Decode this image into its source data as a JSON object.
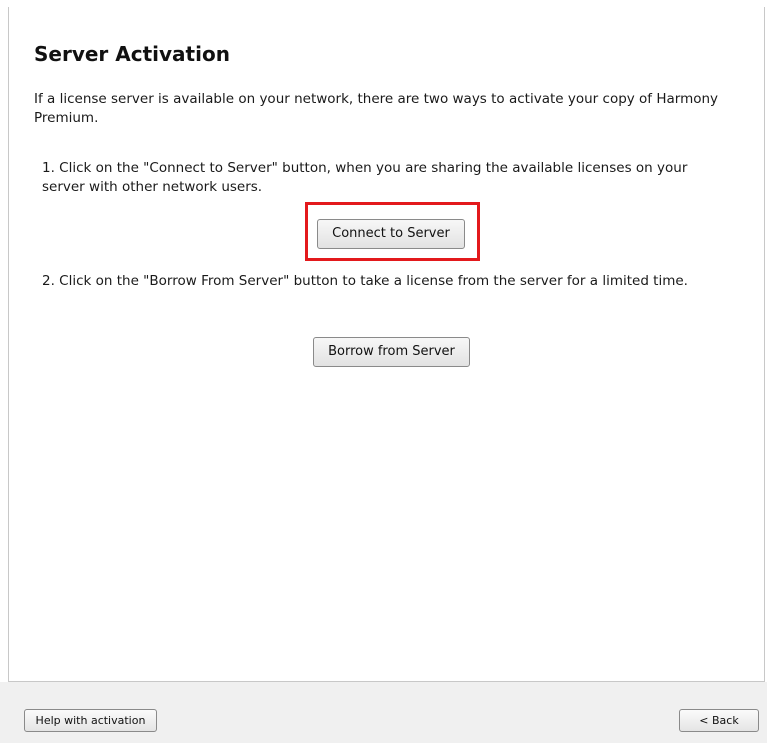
{
  "page": {
    "title": "Server Activation",
    "intro": "If a license server is available on your network, there are two ways to activate your copy of Harmony Premium.",
    "step1_text": "1. Click on the \"Connect to Server\" button, when you are sharing the available licenses on your server with other network users.",
    "step2_text": "2. Click on the \"Borrow From Server\" button to take a license from the server for a limited time.",
    "connect_button_label": "Connect to Server",
    "borrow_button_label": "Borrow from Server"
  },
  "footer": {
    "help_button_label": "Help with activation",
    "back_button_label": "< Back"
  },
  "colors": {
    "highlight": "#e3191c",
    "footer_background": "#f0f0f0"
  }
}
